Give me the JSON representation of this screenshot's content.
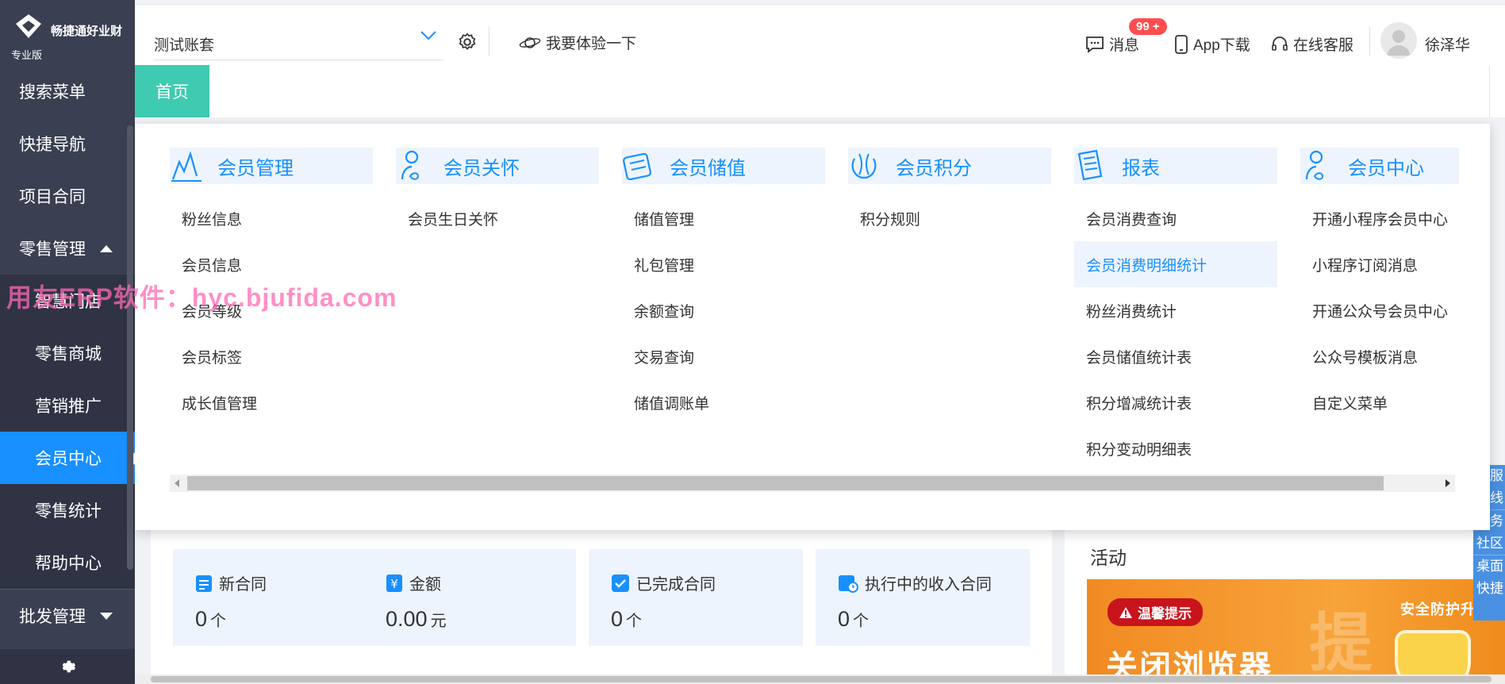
{
  "brand": {
    "name": "畅捷通好业财",
    "edition": "专业版"
  },
  "sidebar": {
    "items": [
      {
        "label": "搜索菜单"
      },
      {
        "label": "快捷导航"
      },
      {
        "label": "项目合同"
      },
      {
        "label": "零售管理",
        "expanded": true
      },
      {
        "label": "智慧门店"
      },
      {
        "label": "零售商城"
      },
      {
        "label": "营销推广"
      },
      {
        "label": "会员中心",
        "active": true
      },
      {
        "label": "零售统计"
      },
      {
        "label": "帮助中心"
      },
      {
        "label": "批发管理",
        "expanded": false
      }
    ]
  },
  "topbar": {
    "account": "测试账套",
    "try_label": "我要体验一下",
    "messages_label": "消息",
    "messages_badge": "99 +",
    "app_download": "App下载",
    "online_service": "在线客服",
    "username": "徐泽华"
  },
  "tabs": [
    {
      "label": "首页"
    }
  ],
  "mega_menu": {
    "columns": [
      {
        "title": "会员管理",
        "icon": "member-manage-icon",
        "items": [
          "粉丝信息",
          "会员信息",
          "会员等级",
          "会员标签",
          "成长值管理"
        ]
      },
      {
        "title": "会员关怀",
        "icon": "member-care-icon",
        "items": [
          "会员生日关怀"
        ]
      },
      {
        "title": "会员储值",
        "icon": "stored-value-icon",
        "items": [
          "储值管理",
          "礼包管理",
          "余额查询",
          "交易查询",
          "储值调账单"
        ]
      },
      {
        "title": "会员积分",
        "icon": "points-icon",
        "items": [
          "积分规则"
        ]
      },
      {
        "title": "报表",
        "icon": "report-icon",
        "items": [
          "会员消费查询",
          "会员消费明细统计",
          "粉丝消费统计",
          "会员储值统计表",
          "积分增减统计表",
          "积分变动明细表"
        ],
        "highlighted": "会员消费明细统计"
      },
      {
        "title": "会员中心",
        "icon": "member-center-icon",
        "items": [
          "开通小程序会员中心",
          "小程序订阅消息",
          "开通公众号会员中心",
          "公众号模板消息",
          "自定义菜单"
        ]
      }
    ]
  },
  "stats": [
    {
      "label": "新合同",
      "value": "0",
      "unit": "个"
    },
    {
      "label": "金额",
      "value": "0.00",
      "unit": "元"
    },
    {
      "label": "已完成合同",
      "value": "0",
      "unit": "个"
    },
    {
      "label": "执行中的收入合同",
      "value": "0",
      "unit": "个"
    }
  ],
  "activity": {
    "title": "活动",
    "banner_tag": "温馨提示",
    "banner_right": "安全防护升级",
    "banner_main": "关闭浏览器",
    "banner_big": "提"
  },
  "side_float": [
    "客服",
    "在线",
    "服务",
    "社区",
    "桌面",
    "快捷"
  ],
  "watermark": "用友ERP软件：hyc.bjufida.com",
  "colors": {
    "accent": "#1890ff",
    "sidebar": "#3a3f51",
    "tab": "#3ecbb1",
    "badge": "#ff4d4f"
  }
}
